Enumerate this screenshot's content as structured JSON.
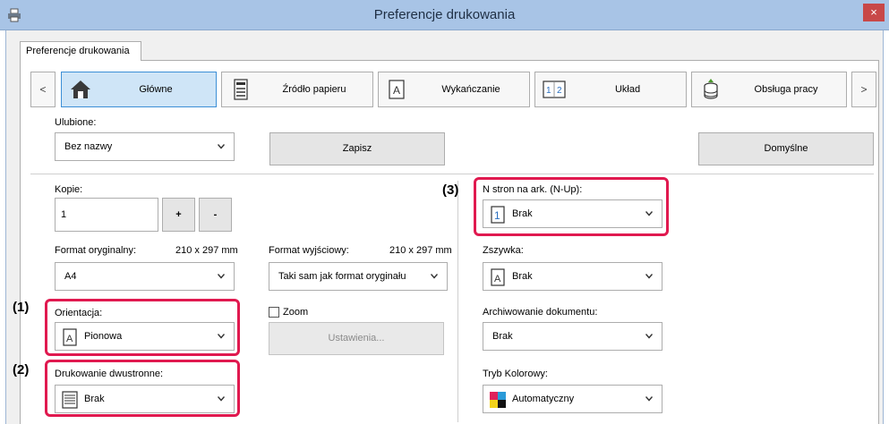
{
  "window": {
    "title": "Preferencje drukowania",
    "close_glyph": "×"
  },
  "tab": {
    "label": "Preferencje drukowania"
  },
  "nav": {
    "prev_glyph": "<",
    "next_glyph": ">",
    "categories": [
      {
        "label": "Główne",
        "icon": "home-icon",
        "active": true
      },
      {
        "label": "Źródło papieru",
        "icon": "paper-tray-icon",
        "active": false
      },
      {
        "label": "Wykańczanie",
        "icon": "finishing-icon",
        "active": false
      },
      {
        "label": "Układ",
        "icon": "layout-icon",
        "active": false
      },
      {
        "label": "Obsługa pracy",
        "icon": "job-handling-icon",
        "active": false
      }
    ]
  },
  "favorites": {
    "label": "Ulubione:",
    "value": "Bez nazwy",
    "save_label": "Zapisz",
    "default_label": "Domyślne"
  },
  "copies": {
    "label": "Kopie:",
    "value": "1",
    "plus": "+",
    "minus": "-"
  },
  "original_size": {
    "label": "Format oryginalny:",
    "dimensions": "210 x 297 mm",
    "value": "A4"
  },
  "output_size": {
    "label": "Format wyjściowy:",
    "dimensions": "210 x 297 mm",
    "value": "Taki sam jak format oryginału"
  },
  "orientation": {
    "label": "Orientacja:",
    "value": "Pionowa",
    "icon_glyph": "A"
  },
  "zoom": {
    "label": "Zoom",
    "checked": false,
    "settings_label": "Ustawienia..."
  },
  "duplex": {
    "label": "Drukowanie dwustronne:",
    "value": "Brak"
  },
  "nup": {
    "label": "N stron na ark. (N-Up):",
    "value": "Brak",
    "icon_glyph": "1"
  },
  "staple": {
    "label": "Zszywka:",
    "value": "Brak",
    "icon_glyph": "A"
  },
  "archiving": {
    "label": "Archiwowanie dokumentu:",
    "value": "Brak"
  },
  "color_mode": {
    "label": "Tryb Kolorowy:",
    "value": "Automatyczny"
  },
  "callouts": {
    "c1": "(1)",
    "c2": "(2)",
    "c3": "(3)"
  },
  "colors": {
    "highlight": "#e0194f",
    "active_tab_bg": "#cfe5f7",
    "active_tab_border": "#3d8fd6",
    "titlebar": "#a8c4e6"
  }
}
